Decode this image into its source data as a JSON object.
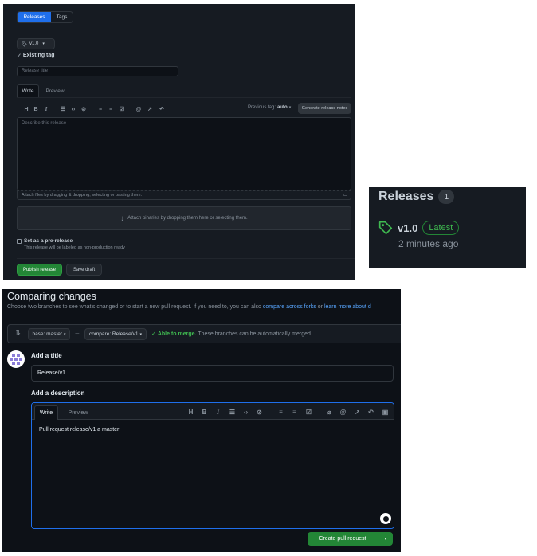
{
  "release_form": {
    "tabs": [
      "Releases",
      "Tags"
    ],
    "tag_select": "v1.0",
    "tag_status": "Existing tag",
    "title_placeholder": "Release title",
    "editor_tabs": [
      "Write",
      "Preview"
    ],
    "toolbar_icons": [
      "heading-icon",
      "bold-icon",
      "italic-icon",
      "quote-icon",
      "code-icon",
      "link-icon",
      "bulleted-list-icon",
      "numbered-list-icon",
      "task-list-icon",
      "mention-icon",
      "cross-reference-icon",
      "undo-icon"
    ],
    "toolbar_glyphs": {
      "heading": "H",
      "bold": "B",
      "italic": "I"
    },
    "previous_tag_label": "Previous tag:",
    "previous_tag_value": "auto",
    "generate_notes_button": "Generate release notes",
    "body_placeholder": "Describe this release",
    "attach_hint": "Attach files by dragging & dropping, selecting or pasting them.",
    "binaries_hint": "Attach binaries by dropping them here or selecting them.",
    "prerelease_label": "Set as a pre-release",
    "prerelease_hint": "This release will be labeled as non-production ready",
    "publish_button": "Publish release",
    "save_draft_button": "Save draft"
  },
  "releases_sidebar": {
    "heading": "Releases",
    "count": "1",
    "release_name": "v1.0",
    "latest_badge": "Latest",
    "time_ago": "2 minutes ago"
  },
  "compare": {
    "title": "Comparing changes",
    "subtitle": "Choose two branches to see what’s changed or to start a new pull request. If you need to, you can also ",
    "link_forks": "compare across forks",
    "or_text": " or ",
    "link_learn": "learn more about d",
    "base_label": "base: master",
    "compare_label": "compare: Release/v1",
    "merge_status": "Able to merge.",
    "merge_note": "These branches can be automatically merged.",
    "add_title_label": "Add a title",
    "title_value": "Release/v1",
    "add_description_label": "Add a description",
    "editor_tabs": [
      "Write",
      "Preview"
    ],
    "description_text": "Pull request release/v1 a master",
    "create_button": "Create pull request"
  },
  "colors": {
    "accent_blue": "#1f6feb",
    "success_green": "#238636",
    "latest_green": "#3fb950",
    "link_blue": "#58a6ff"
  }
}
